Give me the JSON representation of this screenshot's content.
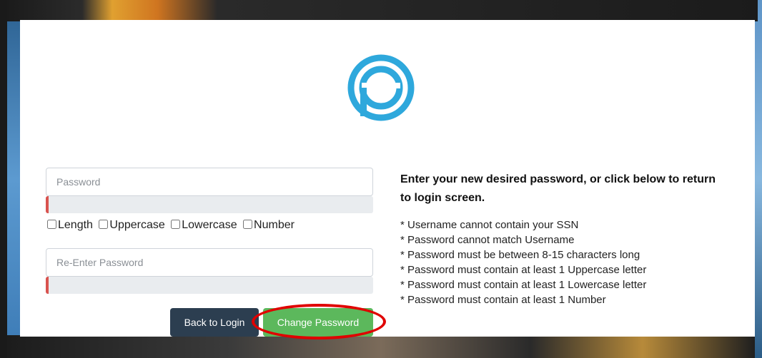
{
  "colors": {
    "brand": "#2ea8dc",
    "back_button": "#2c3e50",
    "change_button": "#5cb85c",
    "strength_error": "#d9534f",
    "annotation": "#e00000"
  },
  "logo": {
    "icon": "brand-p-logo-icon"
  },
  "form": {
    "password_placeholder": "Password",
    "reenter_placeholder": "Re-Enter Password",
    "checks": [
      {
        "label": "Length",
        "checked": false
      },
      {
        "label": "Uppercase",
        "checked": false
      },
      {
        "label": "Lowercase",
        "checked": false
      },
      {
        "label": "Number",
        "checked": false
      }
    ],
    "back_label": "Back to Login",
    "change_label": "Change Password"
  },
  "info": {
    "title": "Enter your new desired password, or click below to return to login screen.",
    "rules": [
      "* Username cannot contain your SSN",
      "* Password cannot match Username",
      "* Password must be between 8-15 characters long",
      "* Password must contain at least 1 Uppercase letter",
      "* Password must contain at least 1 Lowercase letter",
      "* Password must contain at least 1 Number"
    ]
  }
}
